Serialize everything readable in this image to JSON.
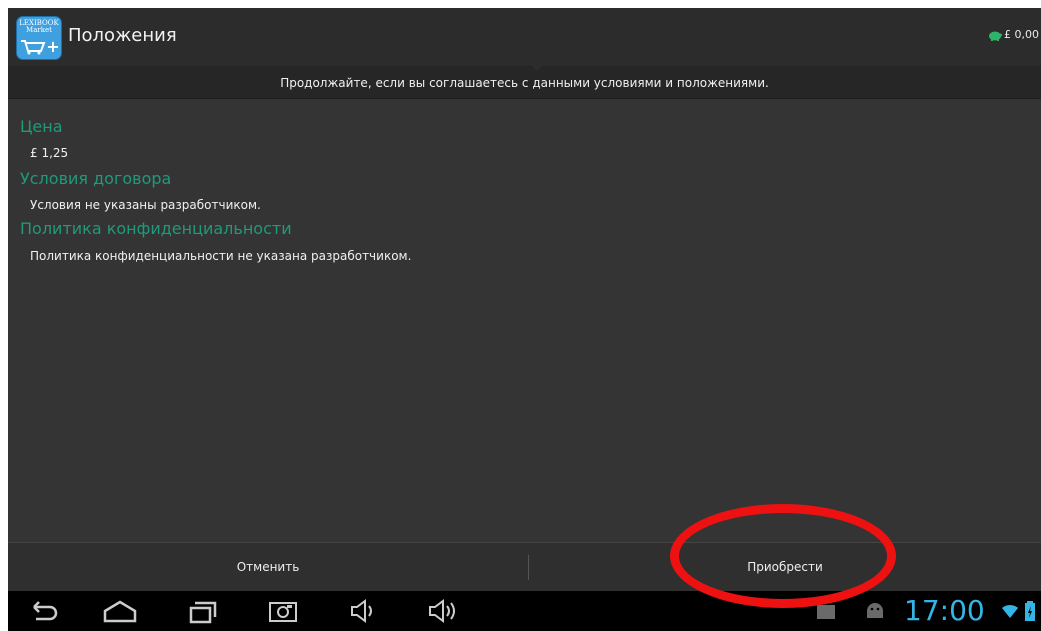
{
  "app": {
    "logo_text": "LEXIBOOK Market",
    "title": "Положения",
    "balance": "£ 0,00"
  },
  "notice": {
    "text": "Продолжайте, если вы соглашаетесь с данными условиями и положениями."
  },
  "sections": [
    {
      "title": "Цена",
      "text": "£ 1,25"
    },
    {
      "title": "Условия договора",
      "text": "Условия не указаны разработчиком."
    },
    {
      "title": "Политика конфиденциальности",
      "text": "Политика конфиденциальности не указана разработчиком."
    }
  ],
  "buttons": {
    "cancel": "Отменить",
    "buy": "Приобрести"
  },
  "status": {
    "time": "17:00"
  },
  "colors": {
    "section_title": "#1f9a7a",
    "clock": "#33b5e5",
    "highlight": "#ee1111"
  },
  "icons": [
    "back-icon",
    "home-icon",
    "recent-apps-icon",
    "screenshot-icon",
    "volume-down-icon",
    "volume-up-icon",
    "notification-icons",
    "wifi-icon",
    "battery-icon",
    "piggy-bank-icon"
  ]
}
